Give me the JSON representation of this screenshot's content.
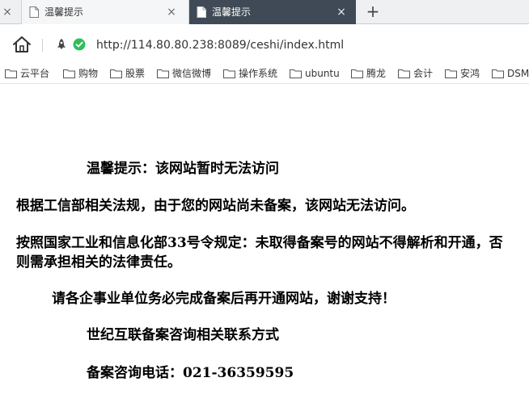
{
  "browser": {
    "tabs": [
      {
        "title": "温馨提示",
        "active": false
      },
      {
        "title": "温馨提示",
        "active": true
      }
    ],
    "tab_close_glyph": "×",
    "new_tab_glyph": "+",
    "url": "http://114.80.80.238:8089/ceshi/index.html",
    "bookmarks": [
      {
        "label": "云平台",
        "icon": "folder-icon"
      },
      {
        "label": "购物",
        "icon": "folder-icon"
      },
      {
        "label": "股票",
        "icon": "folder-icon"
      },
      {
        "label": "微信微博",
        "icon": "folder-icon"
      },
      {
        "label": "操作系统",
        "icon": "folder-icon"
      },
      {
        "label": "ubuntu",
        "icon": "folder-icon"
      },
      {
        "label": "腾龙",
        "icon": "folder-icon"
      },
      {
        "label": "会计",
        "icon": "folder-icon"
      },
      {
        "label": "安鸿",
        "icon": "folder-icon"
      },
      {
        "label": "DSM",
        "icon": "folder-icon"
      }
    ],
    "colors": {
      "active_tab": "#3f4a56",
      "shield_green": "#2fbf5a"
    }
  },
  "page": {
    "heading": "温馨提示：该网站暂时无法访问",
    "para1": "根据工信部相关法规，由于您的网站尚未备案，该网站无法访问。",
    "para2": "按照国家工业和信息化部33号令规定：未取得备案号的网站不得解析和开通，否则需承担相关的法律责任。",
    "para3": "请各企事业单位务必完成备案后再开通网站，谢谢支持！",
    "contact_title": "世纪互联备案咨询相关联系方式",
    "phone": "备案咨询电话：021-36359595"
  }
}
